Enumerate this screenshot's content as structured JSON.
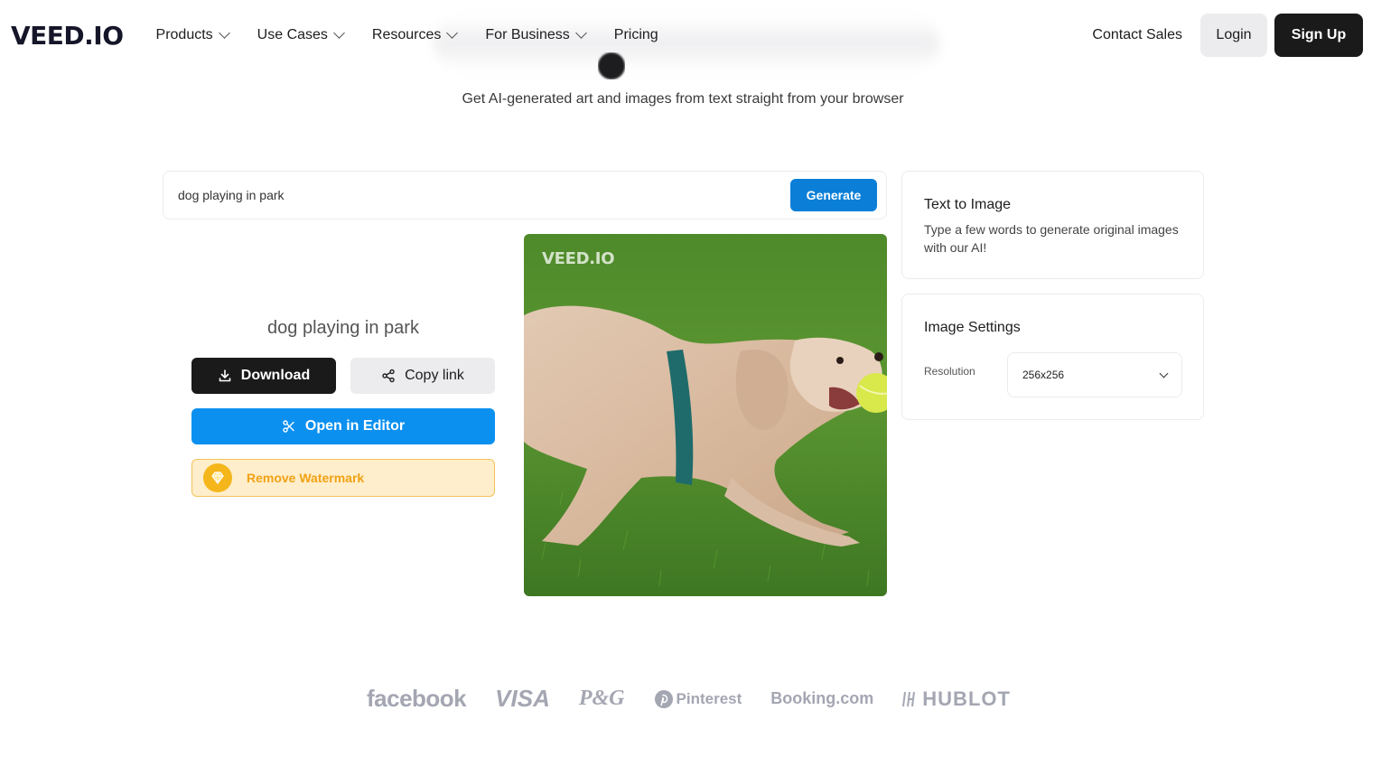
{
  "header": {
    "logo": "VEED.IO",
    "nav": [
      {
        "label": "Products",
        "has_dropdown": true
      },
      {
        "label": "Use Cases",
        "has_dropdown": true
      },
      {
        "label": "Resources",
        "has_dropdown": true
      },
      {
        "label": "For Business",
        "has_dropdown": true
      },
      {
        "label": "Pricing",
        "has_dropdown": false
      }
    ],
    "contact_sales": "Contact Sales",
    "login": "Login",
    "signup": "Sign Up"
  },
  "hero": {
    "subtitle": "Get AI-generated art and images from text straight from your browser"
  },
  "prompt": {
    "value": "dog playing in park",
    "generate_label": "Generate"
  },
  "result": {
    "caption": "dog playing in park",
    "download_label": "Download",
    "copy_link_label": "Copy link",
    "open_editor_label": "Open in Editor",
    "remove_watermark_label": "Remove Watermark",
    "image_watermark": "VEED.IO"
  },
  "text_to_image_card": {
    "title": "Text to Image",
    "description": "Type a few words to generate original images with our AI!"
  },
  "image_settings_card": {
    "title": "Image Settings",
    "resolution_label": "Resolution",
    "resolution_value": "256x256"
  },
  "brand_logos": [
    "facebook",
    "VISA",
    "P&G",
    "Pinterest",
    "Booking.com",
    "HUBLOT"
  ],
  "colors": {
    "primary_dark": "#1a1a1a",
    "generate_blue": "#0b7fd8",
    "editor_blue": "#0b90f0",
    "watermark_bg": "#ffeecb",
    "watermark_text": "#f0a214",
    "logo_gray": "#a4a6b2"
  }
}
